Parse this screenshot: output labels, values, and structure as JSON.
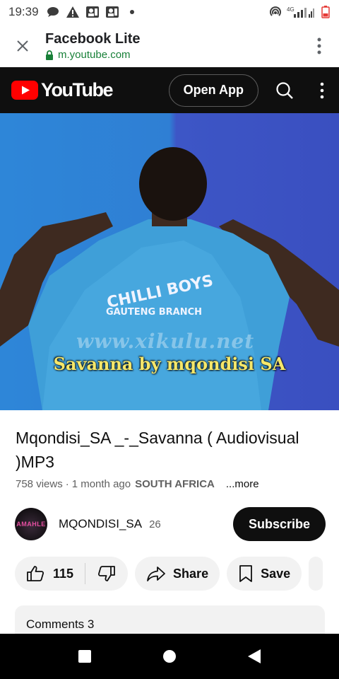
{
  "status_bar": {
    "time": "19:39",
    "network_label": "4G"
  },
  "tab_header": {
    "title": "Facebook Lite",
    "url": "m.youtube.com"
  },
  "yt_header": {
    "logo_text": "YouTube",
    "open_app_label": "Open App"
  },
  "video": {
    "watermark": "www.xikulu.net",
    "caption": "Savanna by mqondisi SA"
  },
  "video_info": {
    "title": "Mqondisi_SA _-_Savanna ( Audiovisual )MP3",
    "views": "758 views",
    "separator": "·",
    "age": "1 month ago",
    "location": "SOUTH AFRICA",
    "more_label": "...more"
  },
  "channel": {
    "name": "MQONDISI_SA",
    "subscriber_count": "26",
    "avatar_text": "AMAHLE",
    "subscribe_label": "Subscribe"
  },
  "actions": {
    "like_count": "115",
    "share_label": "Share",
    "save_label": "Save"
  },
  "comments": {
    "label": "Comments 3"
  },
  "colors": {
    "brand_red": "#ff0000",
    "secure_green": "#188038",
    "header_bg": "#0f0f0f"
  }
}
